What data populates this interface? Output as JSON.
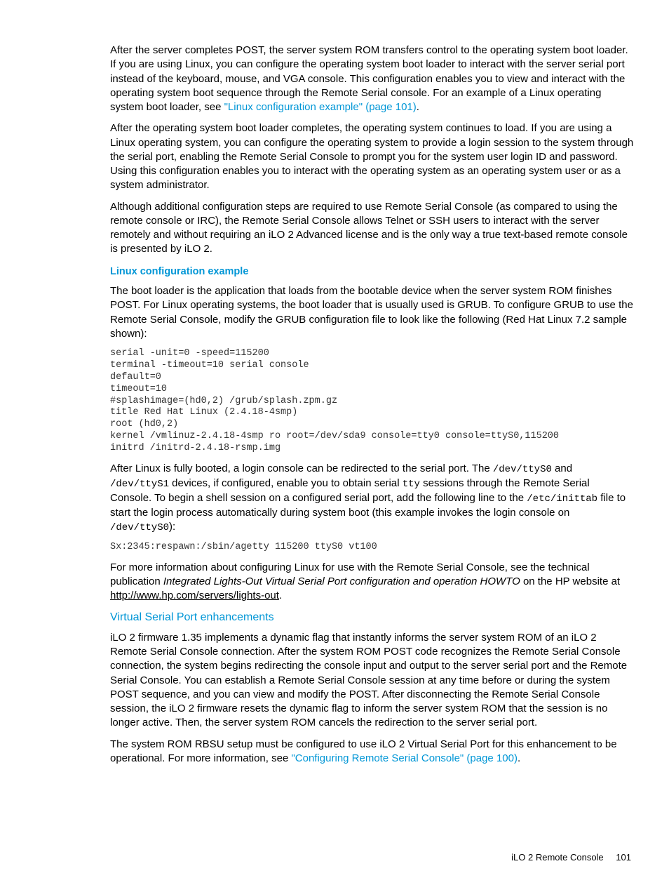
{
  "para1_a": "After the server completes POST, the server system ROM transfers control to the operating system boot loader. If you are using Linux, you can configure the operating system boot loader to interact with the server serial port instead of the keyboard, mouse, and VGA console. This configuration enables you to view and interact with the operating system boot sequence through the Remote Serial console. For an example of a Linux operating system boot loader, see ",
  "para1_link": "\"Linux configuration example\" (page 101)",
  "para1_b": ".",
  "para2": "After the operating system boot loader completes, the operating system continues to load. If you are using a Linux operating system, you can configure the operating system to provide a login session to the system through the serial port, enabling the Remote Serial Console to prompt you for the system user login ID and password. Using this configuration enables you to interact with the operating system as an operating system user or as a system administrator.",
  "para3": "Although additional configuration steps are required to use Remote Serial Console (as compared to using the remote console or IRC), the Remote Serial Console allows Telnet or SSH users to interact with the server remotely and without requiring an iLO 2 Advanced license and is the only way a true text-based remote console is presented by iLO 2.",
  "h_linux": "Linux configuration example",
  "para4": "The boot loader is the application that loads from the bootable device when the server system ROM finishes POST. For Linux operating systems, the boot loader that is usually used is GRUB. To configure GRUB to use the Remote Serial Console, modify the GRUB configuration file to look like the following (Red Hat Linux 7.2 sample shown):",
  "code1": "serial -unit=0 -speed=115200\nterminal -timeout=10 serial console\ndefault=0\ntimeout=10\n#splashimage=(hd0,2) /grub/splash.zpm.gz\ntitle Red Hat Linux (2.4.18-4smp)\nroot (hd0,2)\nkernel /vmlinuz-2.4.18-4smp ro root=/dev/sda9 console=tty0 console=ttyS0,115200\ninitrd /initrd-2.4.18-rsmp.img",
  "para5_a": "After Linux is fully booted, a login console can be redirected to the serial port. The ",
  "para5_m1": "/dev/ttyS0",
  "para5_b": " and ",
  "para5_m2": "/dev/ttyS1",
  "para5_c": " devices, if configured, enable you to obtain serial ",
  "para5_m3": "tty",
  "para5_d": " sessions through the Remote Serial Console. To begin a shell session on a configured serial port, add the following line to the ",
  "para5_m4": "/etc/inittab",
  "para5_e": " file to start the login process automatically during system boot (this example invokes the login console on ",
  "para5_m5": "/dev/ttyS0",
  "para5_f": "):",
  "code2": "Sx:2345:respawn:/sbin/agetty 115200 ttyS0 vt100",
  "para6_a": "For more information about configuring Linux for use with the Remote Serial Console, see the technical publication ",
  "para6_i": "Integrated Lights-Out Virtual Serial Port configuration and operation HOWTO",
  "para6_b": " on the HP website at ",
  "para6_link": "http://www.hp.com/servers/lights-out",
  "para6_c": ".",
  "h_vsp": "Virtual Serial Port enhancements",
  "para7": "iLO 2 firmware 1.35 implements a dynamic flag that instantly informs the server system ROM of an iLO 2 Remote Serial Console connection. After the system ROM POST code recognizes the Remote Serial Console connection, the system begins redirecting the console input and output to the server serial port and the Remote Serial Console. You can establish a Remote Serial Console session at any time before or during the system POST sequence, and you can view and modify the POST. After disconnecting the Remote Serial Console session, the iLO 2 firmware resets the dynamic flag to inform the server system ROM that the session is no longer active. Then, the server system ROM cancels the redirection to the server serial port.",
  "para8_a": "The system ROM RBSU setup must be configured to use iLO 2 Virtual Serial Port for this enhancement to be operational. For more information, see ",
  "para8_link": "\"Configuring Remote Serial Console\" (page 100)",
  "para8_b": ".",
  "footer_label": "iLO 2 Remote Console",
  "footer_page": "101"
}
